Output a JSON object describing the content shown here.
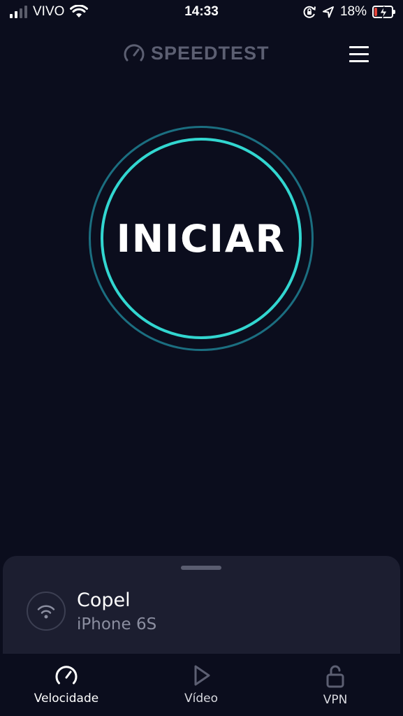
{
  "status_bar": {
    "carrier": "VIVO",
    "time": "14:33",
    "battery_percent": "18%",
    "battery_level": 0.18,
    "icons": [
      "signal-icon",
      "wifi-icon",
      "orientation-lock-icon",
      "location-icon",
      "battery-charging-icon"
    ]
  },
  "header": {
    "brand": "SPEEDTEST",
    "brand_icon": "speedometer-icon",
    "menu_icon": "hamburger-menu-icon"
  },
  "start": {
    "label": "INICIAR"
  },
  "connection": {
    "provider": "Copel",
    "device": "iPhone 6S",
    "icon": "wifi-icon"
  },
  "tabs": [
    {
      "label": "Velocidade",
      "icon": "speedometer-icon",
      "active": true
    },
    {
      "label": "Vídeo",
      "icon": "play-icon",
      "active": false
    },
    {
      "label": "VPN",
      "icon": "unlock-icon",
      "active": false
    }
  ],
  "colors": {
    "background": "#0b0d1d",
    "ring_inner": "#32d6d0",
    "ring_outer": "#1b6e80",
    "sheet": "#1c1e30",
    "battery_low": "#e4443a"
  }
}
